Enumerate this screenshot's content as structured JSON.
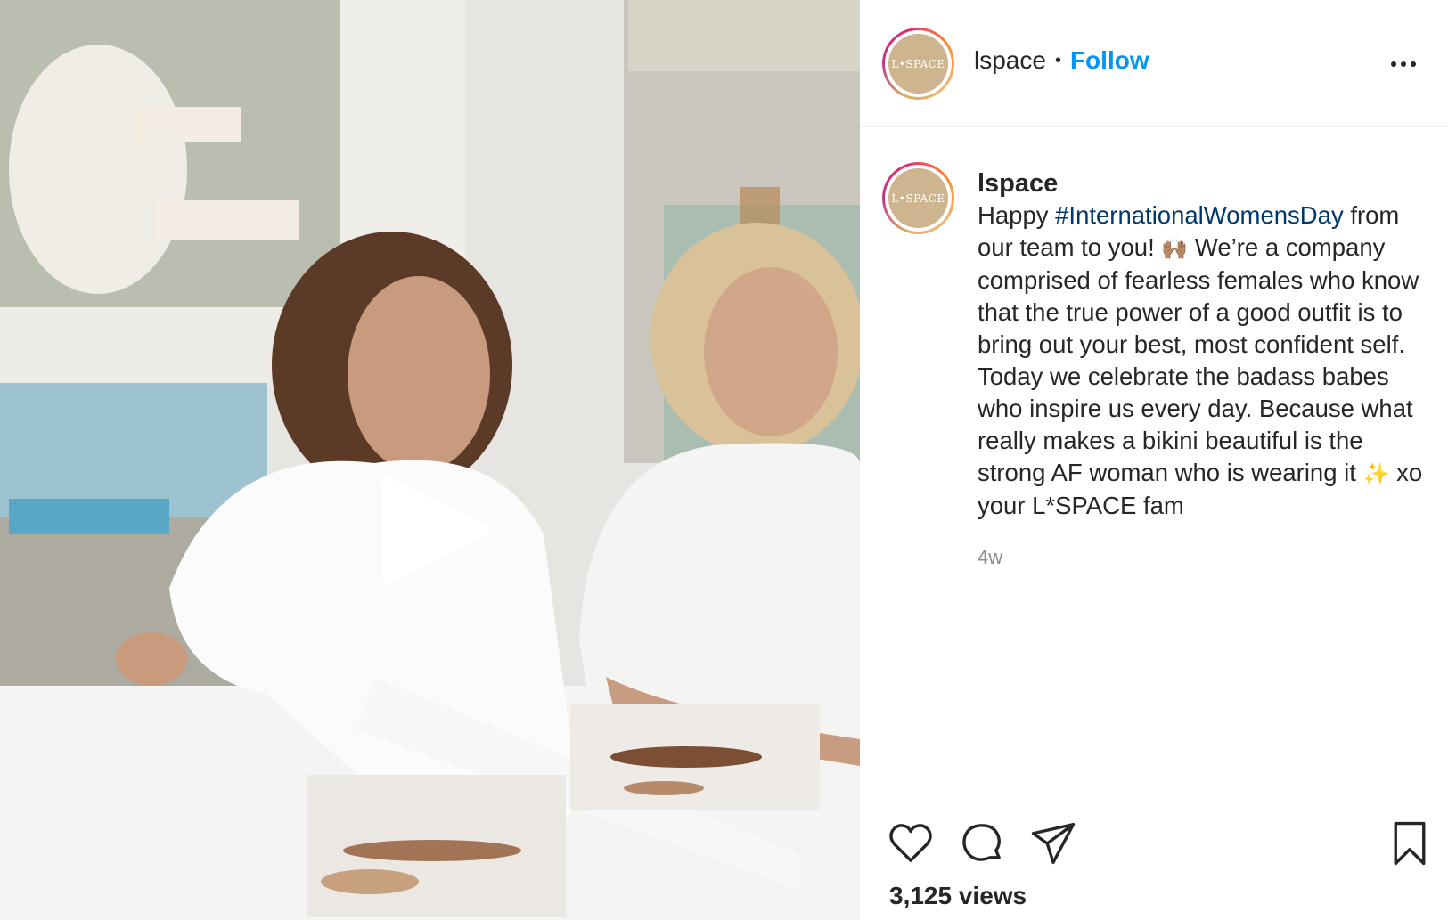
{
  "post": {
    "username": "lspace",
    "separator": "•",
    "follow_label": "Follow",
    "avatar_text": "L•SPACE",
    "caption": {
      "username": "lspace",
      "text_before_hashtag": "Happy ",
      "hashtag": "#InternationalWomensDay",
      "text_after_hashtag": " from our team to you! ",
      "emoji_1": "🙌🏽",
      "text_middle": "  We’re a company comprised of fearless females who know that the true power of a good outfit is to bring out your best, most confident self. Today we celebrate the badass babes who inspire us every day. Because what really makes a bikini beautiful is the strong AF woman who is wearing it ",
      "emoji_2": "✨",
      "text_end": "  xo your L*SPACE fam"
    },
    "timestamp": "4w",
    "views": "3,125 views"
  },
  "icons": {
    "play": "play-icon",
    "more": "more-options-icon",
    "like": "heart-icon",
    "comment": "comment-bubble-icon",
    "share": "paper-plane-icon",
    "save": "bookmark-icon"
  },
  "colors": {
    "follow": "#0095f6",
    "hashtag": "#00376b",
    "muted": "#8e8e8e",
    "text": "#262626"
  }
}
